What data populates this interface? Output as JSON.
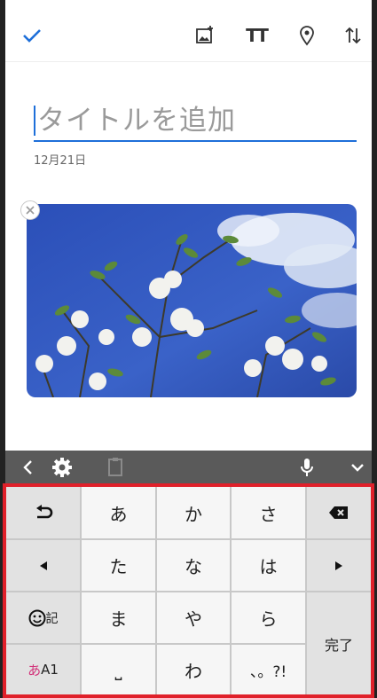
{
  "toolbar": {
    "done_icon": "checkmark-icon",
    "insert_image_icon": "add-image-icon",
    "text_format_label": "TT",
    "location_icon": "location-pin-icon",
    "sort_icon": "sort-arrows-icon",
    "accent_color": "#1e6fd9"
  },
  "note": {
    "title_placeholder": "タイトルを追加",
    "date": "12月21日"
  },
  "keyboard_bar": {
    "back_icon": "chevron-left-icon",
    "settings_icon": "gear-icon",
    "clipboard_icon": "clipboard-icon",
    "mic_icon": "microphone-icon",
    "collapse_icon": "chevron-down-icon"
  },
  "keyboard": {
    "highlight_color": "#e0202a",
    "rows": [
      [
        "undo",
        "あ",
        "か",
        "さ",
        "backspace"
      ],
      [
        "left",
        "た",
        "な",
        "は",
        "right"
      ],
      [
        "emoji",
        "ま",
        "や",
        "ら",
        "done"
      ],
      [
        "mode",
        "space",
        "わ",
        "、。?!",
        ""
      ]
    ],
    "keys": {
      "a": "あ",
      "ka": "か",
      "sa": "さ",
      "ta": "た",
      "na": "な",
      "ha": "は",
      "ma": "ま",
      "ya": "や",
      "ra": "ら",
      "wa": "わ",
      "punct": "、。?!",
      "done": "完了",
      "emoji_label": "記",
      "mode_kana": "あ",
      "mode_alpha": "A1",
      "space_symbol": "⎵"
    }
  }
}
